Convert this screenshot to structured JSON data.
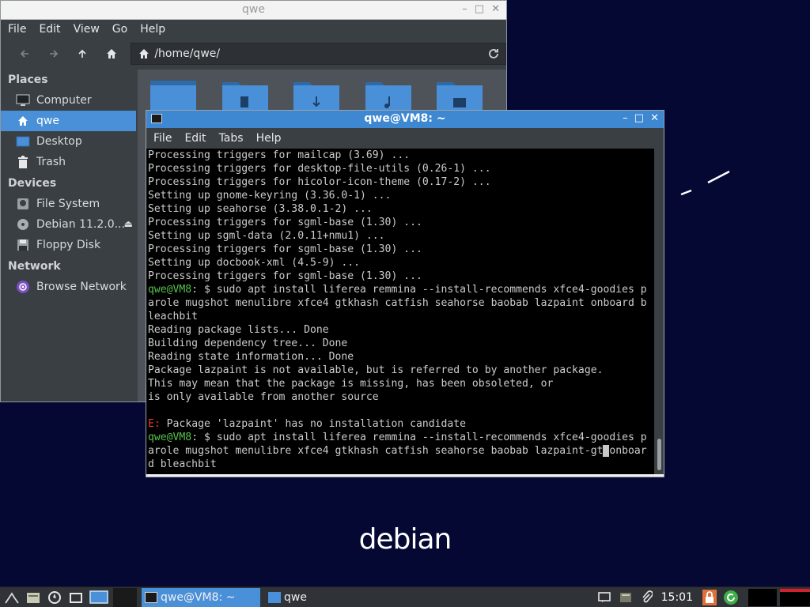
{
  "desktop": {
    "logo_text": "debian"
  },
  "file_manager": {
    "title": "qwe",
    "menu": [
      "File",
      "Edit",
      "View",
      "Go",
      "Help"
    ],
    "path": "/home/qwe/",
    "places_heading": "Places",
    "places": [
      {
        "label": "Computer",
        "icon": "computer-icon",
        "selected": false
      },
      {
        "label": "qwe",
        "icon": "home-icon",
        "selected": true
      },
      {
        "label": "Desktop",
        "icon": "desktop-icon",
        "selected": false
      },
      {
        "label": "Trash",
        "icon": "trash-icon",
        "selected": false
      }
    ],
    "devices_heading": "Devices",
    "devices": [
      {
        "label": "File System",
        "icon": "drive-icon"
      },
      {
        "label": "Debian 11.2.0...",
        "icon": "disc-icon",
        "eject": true
      },
      {
        "label": "Floppy Disk",
        "icon": "floppy-icon"
      }
    ],
    "network_heading": "Network",
    "network": [
      {
        "label": "Browse Network",
        "icon": "network-icon"
      }
    ]
  },
  "terminal": {
    "title": "qwe@VM8: ~",
    "menu": [
      "File",
      "Edit",
      "Tabs",
      "Help"
    ],
    "lines": [
      {
        "type": "text",
        "text": "Processing triggers for mailcap (3.69) ..."
      },
      {
        "type": "text",
        "text": "Processing triggers for desktop-file-utils (0.26-1) ..."
      },
      {
        "type": "text",
        "text": "Processing triggers for hicolor-icon-theme (0.17-2) ..."
      },
      {
        "type": "text",
        "text": "Setting up gnome-keyring (3.36.0-1) ..."
      },
      {
        "type": "text",
        "text": "Setting up seahorse (3.38.0.1-2) ..."
      },
      {
        "type": "text",
        "text": "Processing triggers for sgml-base (1.30) ..."
      },
      {
        "type": "text",
        "text": "Setting up sgml-data (2.0.11+nmu1) ..."
      },
      {
        "type": "text",
        "text": "Processing triggers for sgml-base (1.30) ..."
      },
      {
        "type": "text",
        "text": "Setting up docbook-xml (4.5-9) ..."
      },
      {
        "type": "text",
        "text": "Processing triggers for sgml-base (1.30) ..."
      },
      {
        "type": "prompt",
        "user": "qwe@VM8",
        "rest": ": $ sudo apt install liferea remmina --install-recommends xfce4-goodies p"
      },
      {
        "type": "text",
        "text": "arole mugshot menulibre xfce4 gtkhash catfish seahorse baobab lazpaint onboard b"
      },
      {
        "type": "text",
        "text": "leachbit"
      },
      {
        "type": "text",
        "text": "Reading package lists... Done"
      },
      {
        "type": "text",
        "text": "Building dependency tree... Done"
      },
      {
        "type": "text",
        "text": "Reading state information... Done"
      },
      {
        "type": "text",
        "text": "Package lazpaint is not available, but is referred to by another package."
      },
      {
        "type": "text",
        "text": "This may mean that the package is missing, has been obsoleted, or"
      },
      {
        "type": "text",
        "text": "is only available from another source"
      },
      {
        "type": "text",
        "text": ""
      },
      {
        "type": "error",
        "prefix": "E:",
        "rest": " Package 'lazpaint' has no installation candidate"
      },
      {
        "type": "prompt",
        "user": "qwe@VM8",
        "rest": ": $ sudo apt install liferea remmina --install-recommends xfce4-goodies p"
      },
      {
        "type": "cursor",
        "before": "arole mugshot menulibre xfce4 gtkhash catfish seahorse baobab lazpaint-gt",
        "cursor_char": " ",
        "after": "onboar"
      },
      {
        "type": "text",
        "text": "d bleachbit"
      }
    ]
  },
  "taskbar": {
    "tasks": [
      {
        "label": "qwe@VM8: ~",
        "icon": "terminal-icon",
        "active": true
      },
      {
        "label": "qwe",
        "icon": "folder-icon",
        "active": false
      }
    ],
    "clock": "15:01"
  }
}
